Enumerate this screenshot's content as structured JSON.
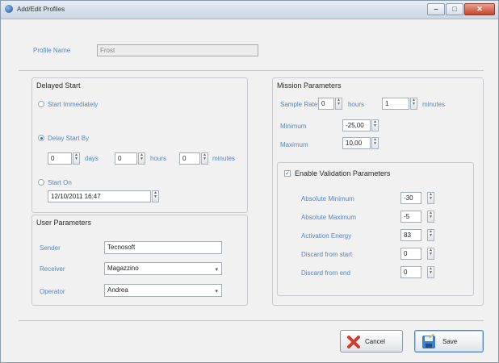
{
  "window": {
    "title": "Add/Edit Profiles",
    "controls": [
      "minimize",
      "maximize",
      "close"
    ]
  },
  "profile": {
    "name_label": "Profile Name",
    "name_value": "Frost"
  },
  "delayed_start": {
    "title": "Delayed Start",
    "option_immediately": "Start Immediately",
    "option_delay": "Delay Start By",
    "delay_days": "0",
    "days_label": "days",
    "delay_hours": "0",
    "hours_label": "hours",
    "delay_minutes": "0",
    "minutes_label": "minutes",
    "option_start_on": "Start On",
    "start_on_value": "12/10/2011 16:47",
    "selected_option": "delay"
  },
  "user_parameters": {
    "title": "User Parameters",
    "sender_label": "Sender",
    "sender_value": "Tecnosoft",
    "receiver_label": "Receiver",
    "receiver_value": "Magazzino",
    "operator_label": "Operator",
    "operator_value": "Andrea"
  },
  "mission_parameters": {
    "title": "Mission Parameters",
    "sample_rate_label": "Sample Rate",
    "sample_hours": "0",
    "hours_label": "hours",
    "sample_minutes": "1",
    "minutes_label": "minutes",
    "minimum_label": "Minimum",
    "minimum_value": "-25,00",
    "maximum_label": "Maximum",
    "maximum_value": "10,00"
  },
  "validation": {
    "title": "Enable Validation Parameters",
    "enabled": true,
    "abs_min_label": "Absolute Minimum",
    "abs_min_value": "-30",
    "abs_max_label": "Absolute Maximum",
    "abs_max_value": "-5",
    "activation_label": "Activation Energy",
    "activation_value": "83",
    "discard_start_label": "Discard from start",
    "discard_start_value": "0",
    "discard_end_label": "Discard from end",
    "discard_end_value": "0"
  },
  "buttons": {
    "cancel": "Cancel",
    "save": "Save"
  },
  "colors": {
    "label_blue": "#5a84bd",
    "cancel_icon": "#d63a2c",
    "save_icon": "#3d7fc8"
  }
}
